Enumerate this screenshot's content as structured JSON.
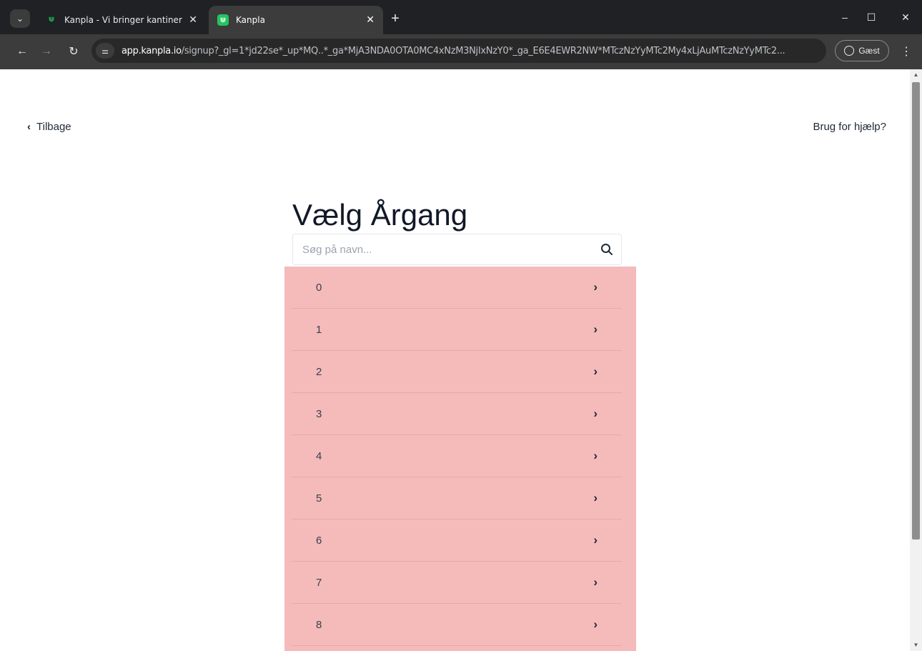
{
  "browser": {
    "tabs": [
      {
        "title": "Kanpla - Vi bringer kantiner ind",
        "active": false
      },
      {
        "title": "Kanpla",
        "active": true
      }
    ],
    "new_tab_label": "+",
    "url_host": "app.kanpla.io",
    "url_rest": "/signup?_gl=1*jd22se*_up*MQ..*_ga*MjA3NDA0OTA0MC4xNzM3NjIxNzY0*_ga_E6E4EWR2NW*MTczNzYyMTc2My4xLjAuMTczNzYyMTc2...",
    "profile_label": "Gæst",
    "accent_color": "#22c55e"
  },
  "page": {
    "back_label": "Tilbage",
    "help_label": "Brug for hjælp?",
    "heading": "Vælg Årgang",
    "search": {
      "placeholder": "Søg på navn...",
      "value": ""
    },
    "list_bg_color": "#f5baba",
    "items": [
      "0",
      "1",
      "2",
      "3",
      "4",
      "5",
      "6",
      "7",
      "8"
    ]
  }
}
